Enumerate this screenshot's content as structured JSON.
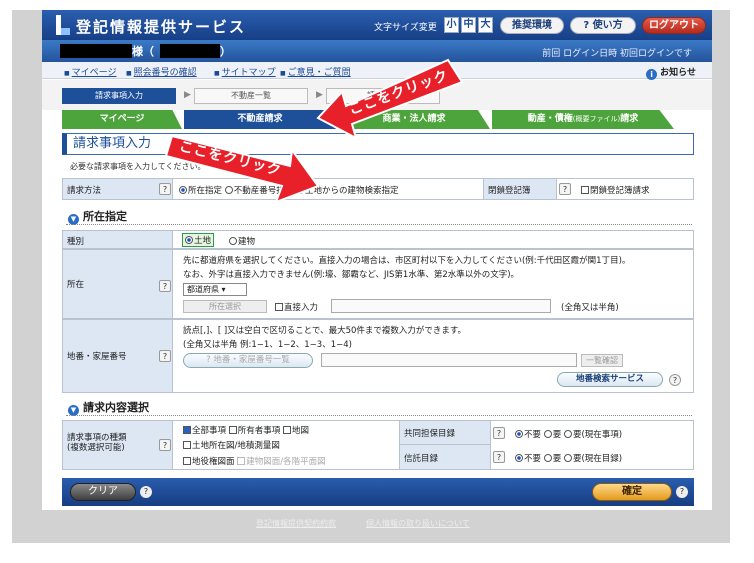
{
  "header": {
    "site_title": "登記情報提供サービス",
    "font_size_label": "文字サイズ変更",
    "font_small": "小",
    "font_medium": "中",
    "font_large": "大",
    "recommended_env": "推奨環境",
    "help": "使い方",
    "help_icon": "?",
    "logout": "ログアウト"
  },
  "user": {
    "suffix": "様（",
    "paren_close": "）",
    "login_info": "前回 ログイン日時 初回ログインです"
  },
  "links": {
    "mypage": "マイページ",
    "confirm_number": "照会番号の確認",
    "sitemap": "サイトマップ",
    "opinion": "ご意見・ご質問",
    "notice": "お知らせ",
    "notice_icon": "i"
  },
  "steps": [
    "請求事項入力",
    "不動産一覧",
    "請求確認"
  ],
  "step_arrow": "▶",
  "tabs": {
    "mypage": "マイページ",
    "real_estate": "不動産請求",
    "corporate": "商業・法人請求",
    "movables_main": "動産・債権",
    "movables_small": "(概要ファイル)",
    "movables_tail": "請求"
  },
  "main": {
    "page_title": "請求事項入力",
    "subnote": "必要な請求事項を入力してください。",
    "help_q": "?",
    "method": {
      "label": "請求方法",
      "opt1": "所在指定",
      "opt2": "不動産番号指定",
      "opt3": "土地からの建物検索指定",
      "closed_label": "閉鎖登記簿",
      "closed_opt": "閉鎖登記簿請求"
    },
    "location_section": "所在指定",
    "section_icon": "▼",
    "type": {
      "label": "種別",
      "opt1": "土地",
      "opt2": "建物"
    },
    "location": {
      "label": "所在",
      "note1": "先に都道府県を選択してください。直接入力の場合は、市区町村以下を入力してください(例:千代田区霞が関1丁目)。",
      "note2": "なお、外字は直接入力できません(例:壕、鄒霸など、JIS第1水準、第2水準以外の文字)。",
      "pref_select": "都道府県",
      "select_arrow": "▾",
      "select_btn": "所在選択",
      "direct_input": "直接入力",
      "width_note": "(全角又は半角)"
    },
    "lot": {
      "label": "地番・家屋番号",
      "note1": "読点[,]、[ ]又は空白で区切ることで、最大50件まで複数入力ができます。",
      "note2": "(全角又は半角 例:1−1、1−2、1−3、1−4)",
      "list_btn": "地番・家屋番号一覧",
      "confirm_btn": "一覧確認",
      "map_service": "地番検索サービス"
    },
    "request_section": "請求内容選択",
    "kinds": {
      "label1": "請求事項の種類",
      "label2": "(複数選択可能)",
      "all": "全部事項",
      "owner": "所有者事項",
      "map": "地図",
      "site_plan": "土地所在図/地積測量図",
      "easement": "地役権図面",
      "building_plan": "建物図面/各階平面図",
      "joint_label": "共同担保目録",
      "joint_opt1": "不要",
      "joint_opt2": "要",
      "joint_opt3": "要(現在事項)",
      "trust_label": "信託目録",
      "trust_opt1": "不要",
      "trust_opt2": "要",
      "trust_opt3": "要(現在目録)"
    }
  },
  "actions": {
    "clear": "クリア",
    "confirm": "確定",
    "help_q": "?"
  },
  "footer": {
    "terms": "登記情報提供契約約款",
    "privacy": "個人情報の取り扱いについて"
  },
  "annotations": {
    "click_here_1": "ここをクリック",
    "click_here_2": "ここをクリック"
  },
  "colors": {
    "header_blue": "#1e4f99",
    "tab_green": "#4ea43c",
    "arrow_red": "#e8202a"
  }
}
